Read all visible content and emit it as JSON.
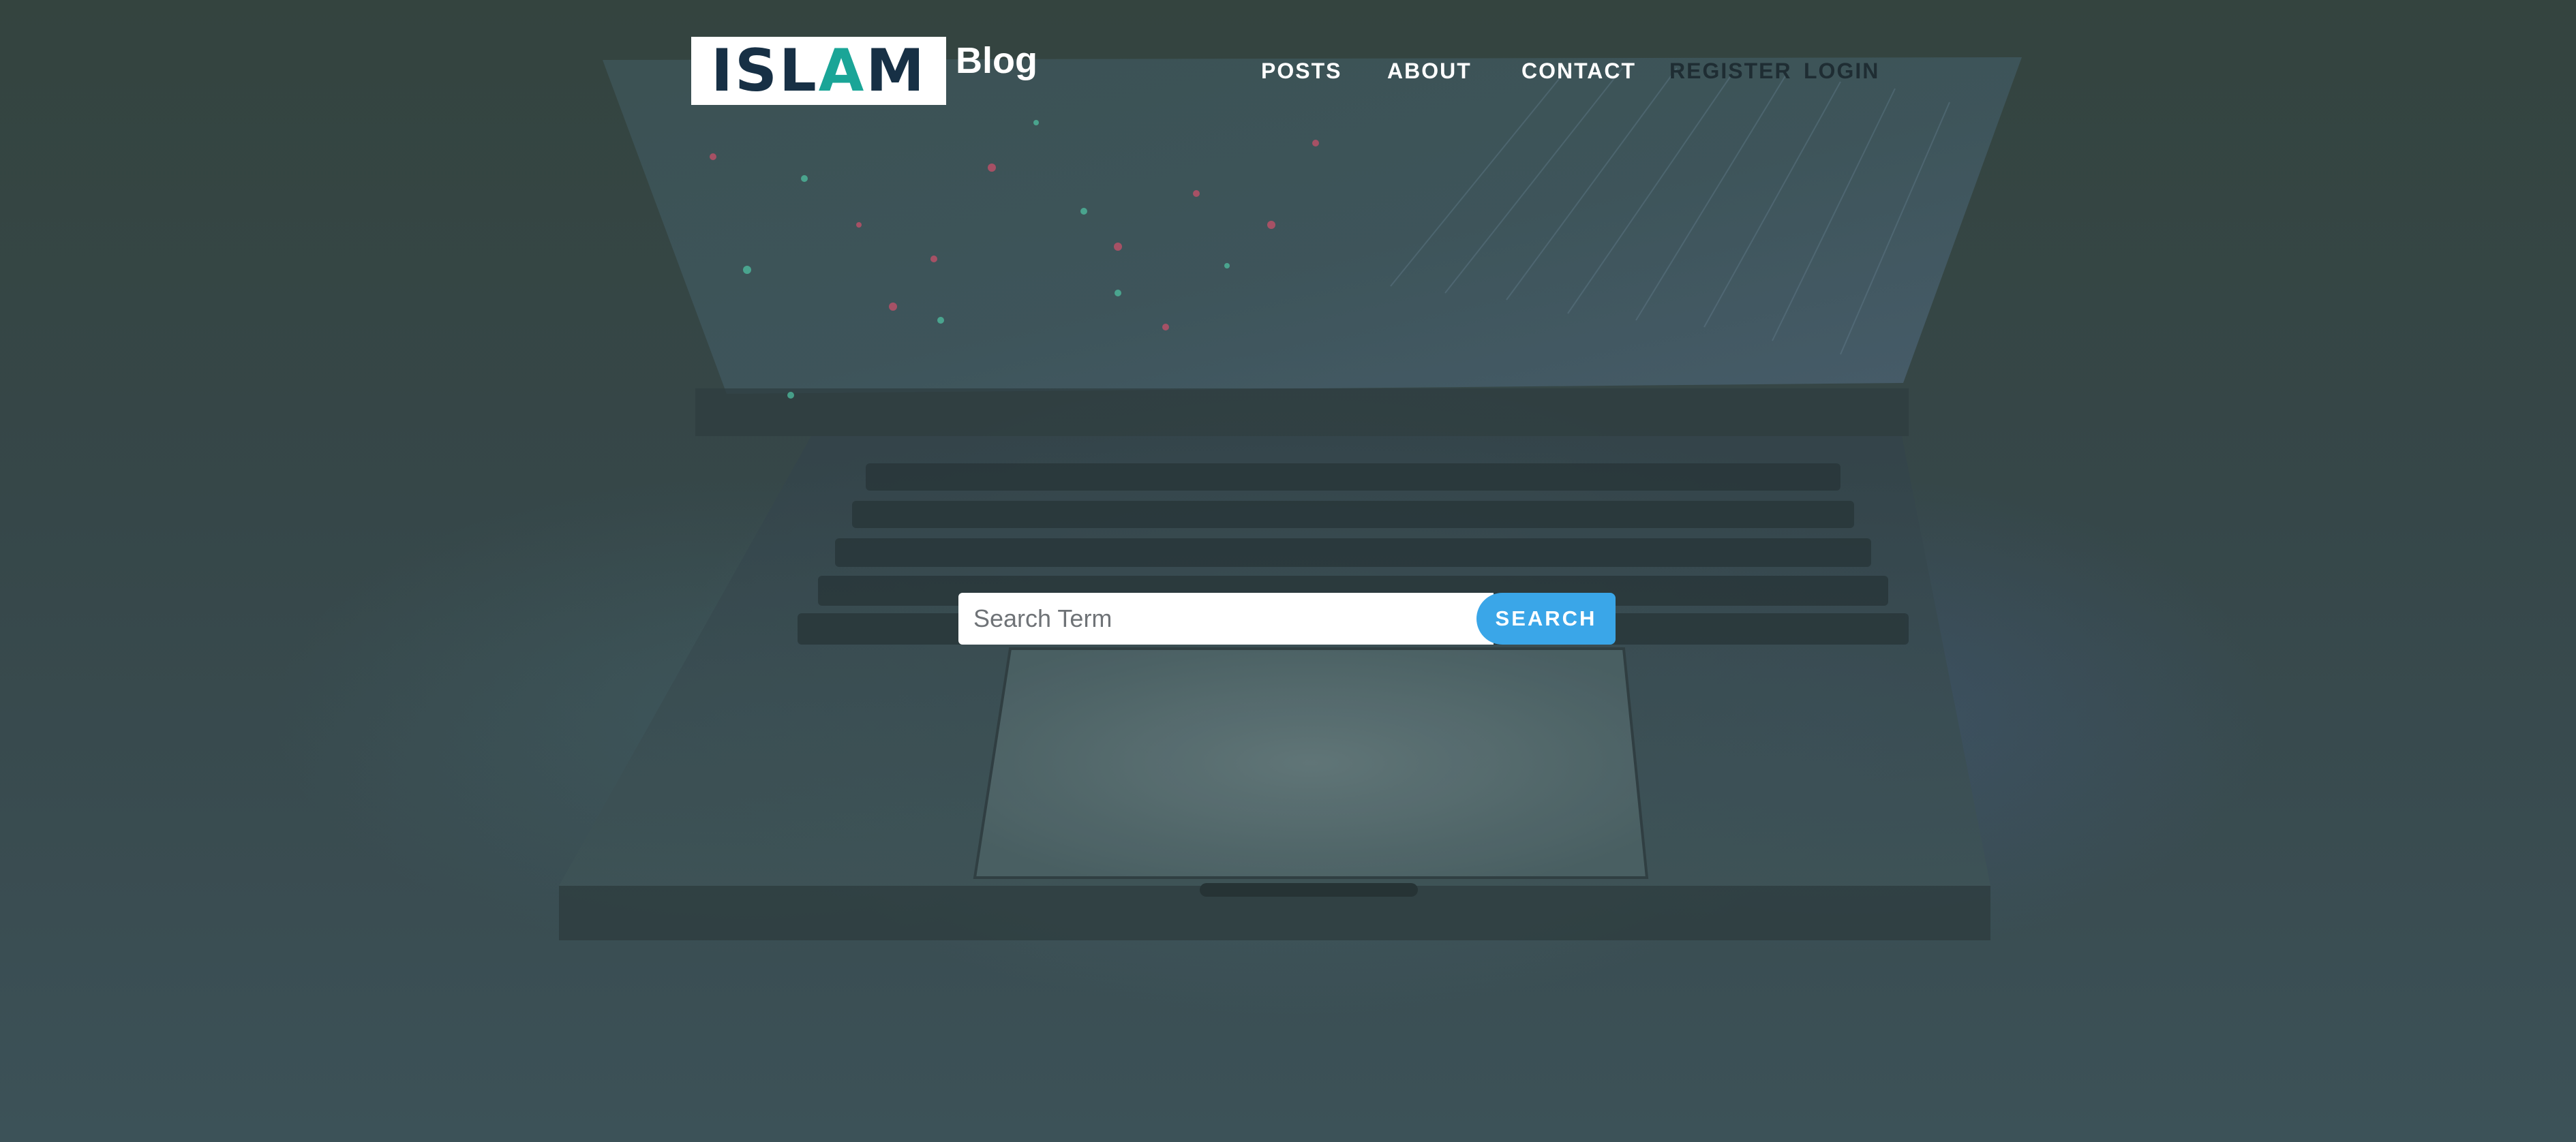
{
  "brand": {
    "logo_text_dark_1": "ISL",
    "logo_text_accent": "A",
    "logo_text_dark_2": "M",
    "blog_label": "Blog",
    "colors": {
      "logo_dark": "#173045",
      "logo_accent": "#1aa597",
      "logo_background": "#ffffff"
    }
  },
  "nav": {
    "items": [
      {
        "label": "POSTS"
      },
      {
        "label": "ABOUT"
      },
      {
        "label": "CONTACT"
      },
      {
        "label": "REGISTER"
      },
      {
        "label": "LOGIN"
      }
    ],
    "colors": {
      "active": "#ffffff",
      "dim": "#1f2d33"
    }
  },
  "search": {
    "placeholder": "Search Term",
    "value": "",
    "button_label": "SEARCH",
    "colors": {
      "button": "#3aa6e8"
    }
  },
  "background": {
    "description_icon": "laptop-keyboard-background",
    "colors": {
      "base": "#36474a",
      "overlay_tint": "#3c5258"
    }
  }
}
